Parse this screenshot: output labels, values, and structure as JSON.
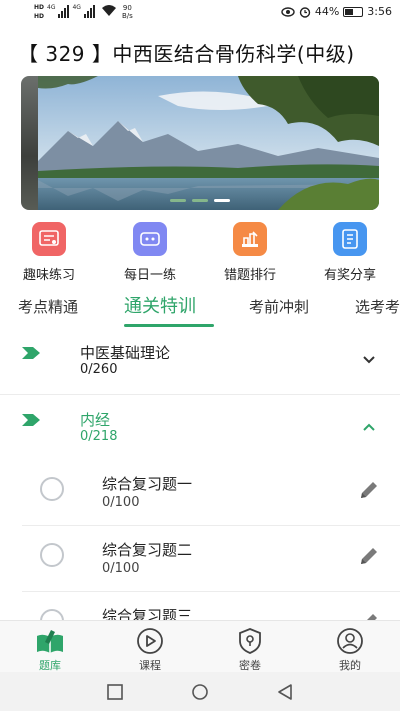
{
  "status_bar": {
    "sim1": "HD",
    "sim1_net": "4G",
    "sim2": "HD",
    "sim2_net": "4G",
    "net_speed_value": "90",
    "net_speed_unit": "B/s",
    "battery": "44%",
    "time": "3:56"
  },
  "page": {
    "title": "【 329 】中西医结合骨伤科学(中级)"
  },
  "banner": {
    "slide_count": 3,
    "active_slide": 3
  },
  "quick_actions": [
    {
      "label": "趣味练习",
      "icon": "practice-icon",
      "color": "#f05a5a"
    },
    {
      "label": "每日一练",
      "icon": "daily-icon",
      "color": "#7b83f0"
    },
    {
      "label": "错题排行",
      "icon": "mistakes-icon",
      "color": "#f5823a"
    },
    {
      "label": "有奖分享",
      "icon": "share-icon",
      "color": "#3b8ff0"
    }
  ],
  "tabs": [
    {
      "label": "考点精通",
      "active": false
    },
    {
      "label": "通关特训",
      "active": true
    },
    {
      "label": "考前冲刺",
      "active": false
    },
    {
      "label": "选考考",
      "active": false
    }
  ],
  "sections": [
    {
      "title": "中医基础理论",
      "count": "0/260",
      "expanded": false
    },
    {
      "title": "内经",
      "count": "0/218",
      "expanded": true
    }
  ],
  "items": [
    {
      "title": "综合复习题一",
      "count": "0/100"
    },
    {
      "title": "综合复习题二",
      "count": "0/100"
    },
    {
      "title": "综合复习题三",
      "count": ""
    }
  ],
  "bottom_nav": [
    {
      "label": "题库",
      "icon": "question-bank-icon",
      "active": true
    },
    {
      "label": "课程",
      "icon": "play-icon",
      "active": false
    },
    {
      "label": "密卷",
      "icon": "secret-exam-icon",
      "active": false
    },
    {
      "label": "我的",
      "icon": "profile-icon",
      "active": false
    }
  ],
  "colors": {
    "accent": "#2fa56a",
    "divider": "#ececec"
  }
}
